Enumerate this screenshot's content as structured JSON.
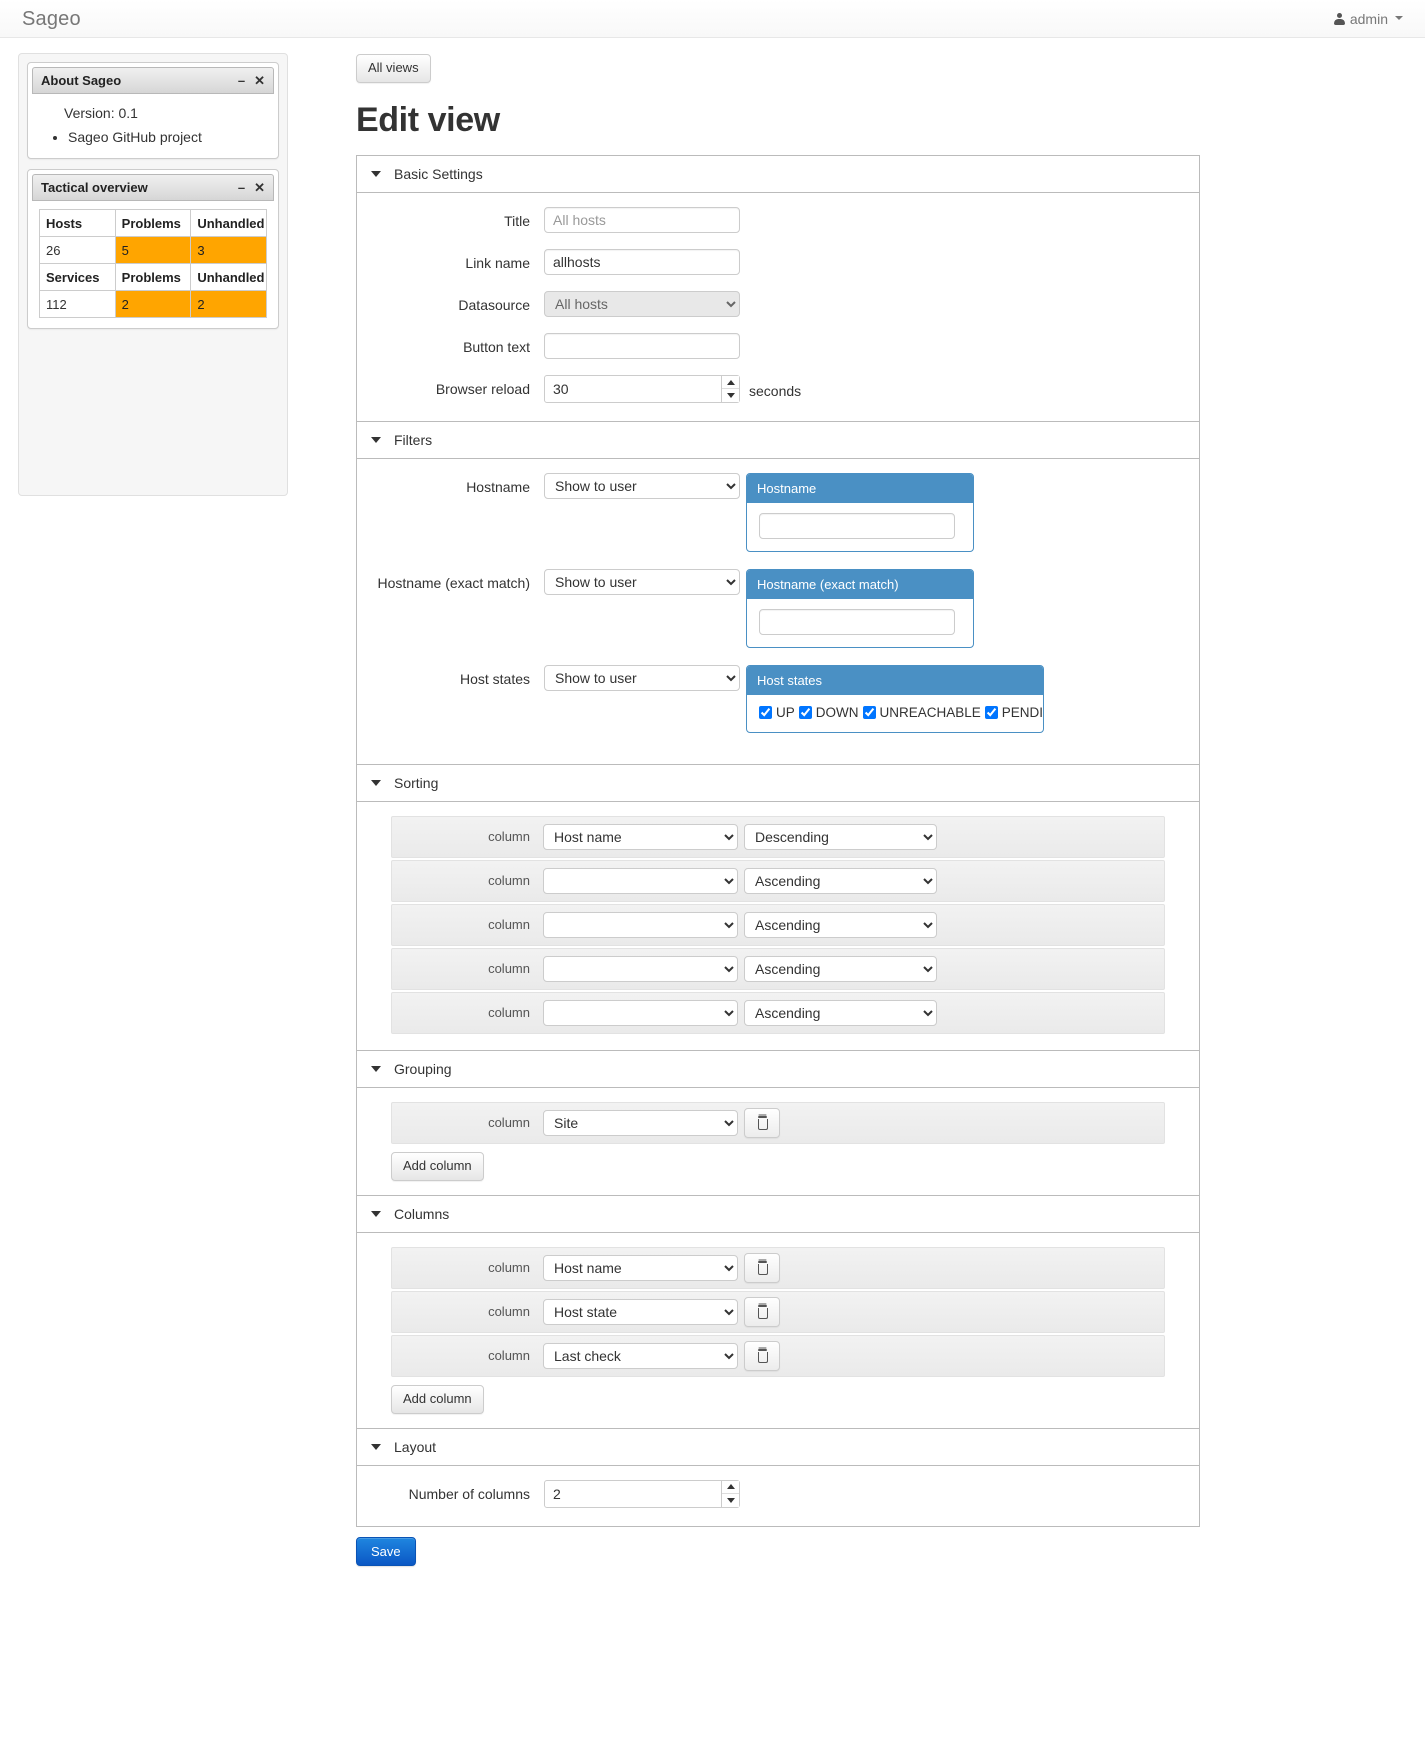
{
  "navbar": {
    "brand": "Sageo",
    "user_label": "admin",
    "user_icon": "user-icon",
    "caret_icon": "caret-down-icon"
  },
  "sidebar": {
    "widgets": [
      {
        "title": "About Sageo",
        "minimize_icon": "minimize-icon",
        "minimize_glyph": "–",
        "close_icon": "close-icon",
        "close_glyph": "✕",
        "version_text": "Version: 0.1",
        "links": [
          "Sageo GitHub project"
        ]
      },
      {
        "title": "Tactical overview",
        "minimize_icon": "minimize-icon",
        "minimize_glyph": "–",
        "close_icon": "close-icon",
        "close_glyph": "✕",
        "tables": [
          {
            "headers": [
              "Hosts",
              "Problems",
              "Unhandled"
            ],
            "row": [
              "26",
              "5",
              "3"
            ]
          },
          {
            "headers": [
              "Services",
              "Problems",
              "Unhandled"
            ],
            "row": [
              "112",
              "2",
              "2"
            ]
          }
        ]
      }
    ]
  },
  "main": {
    "all_views_button": "All views",
    "page_title": "Edit view",
    "save_button": "Save",
    "add_column_button": "Add column",
    "basic_settings": {
      "heading": "Basic Settings",
      "fields": {
        "title": {
          "label": "Title",
          "value": "",
          "placeholder": "All hosts"
        },
        "link_name": {
          "label": "Link name",
          "value": "allhosts",
          "placeholder": ""
        },
        "datasource": {
          "label": "Datasource",
          "value": "All hosts"
        },
        "button_text": {
          "label": "Button text",
          "value": "",
          "placeholder": ""
        },
        "browser_reload": {
          "label": "Browser reload",
          "value": "30",
          "unit": "seconds"
        }
      }
    },
    "filters": {
      "heading": "Filters",
      "rows": [
        {
          "label": "Hostname",
          "mode": "Show to user",
          "panel_title": "Hostname",
          "input_value": "",
          "type": "text"
        },
        {
          "label": "Hostname (exact match)",
          "mode": "Show to user",
          "panel_title": "Hostname (exact match)",
          "input_value": "",
          "type": "text"
        },
        {
          "label": "Host states",
          "mode": "Show to user",
          "panel_title": "Host states",
          "type": "checkboxes",
          "states": [
            {
              "label": "UP",
              "checked": true
            },
            {
              "label": "DOWN",
              "checked": true
            },
            {
              "label": "UNREACHABLE",
              "checked": true
            },
            {
              "label": "PENDING",
              "checked": true
            }
          ]
        }
      ]
    },
    "sorting": {
      "heading": "Sorting",
      "handle_label": "column",
      "rows": [
        {
          "column": "Host name",
          "direction": "Descending"
        },
        {
          "column": "",
          "direction": "Ascending"
        },
        {
          "column": "",
          "direction": "Ascending"
        },
        {
          "column": "",
          "direction": "Ascending"
        },
        {
          "column": "",
          "direction": "Ascending"
        }
      ]
    },
    "grouping": {
      "heading": "Grouping",
      "handle_label": "column",
      "rows": [
        {
          "column": "Site"
        }
      ]
    },
    "columns": {
      "heading": "Columns",
      "handle_label": "column",
      "rows": [
        {
          "column": "Host name"
        },
        {
          "column": "Host state"
        },
        {
          "column": "Last check"
        }
      ]
    },
    "layout": {
      "heading": "Layout",
      "number_of_columns": {
        "label": "Number of columns",
        "value": "2"
      }
    }
  },
  "colors": {
    "filter_panel_blue": "#4a90c4",
    "warning_orange": "#ffa500",
    "primary_blue": "#1f86e0"
  }
}
